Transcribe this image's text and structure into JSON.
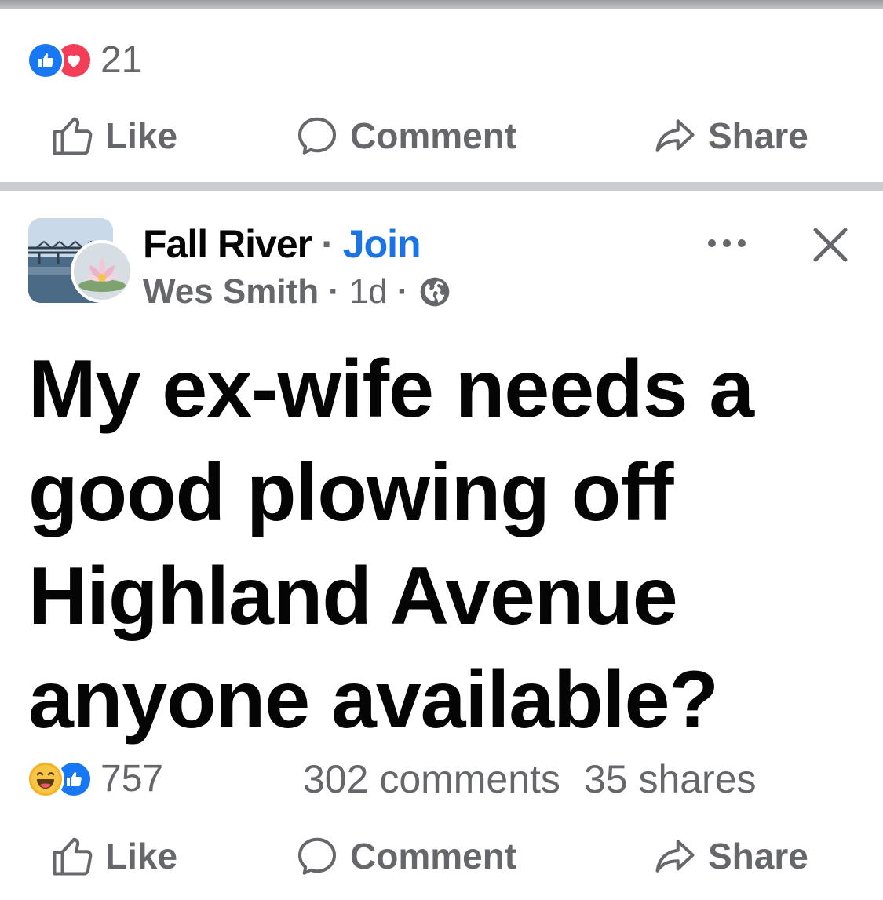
{
  "previous_post": {
    "reaction_count": "21",
    "reaction_icons": [
      "like-icon",
      "love-icon"
    ]
  },
  "actions": {
    "like": "Like",
    "comment": "Comment",
    "share": "Share"
  },
  "post": {
    "group_name": "Fall River",
    "separator": "·",
    "join_label": "Join",
    "author": "Wes Smith",
    "time": "1d",
    "privacy_icon": "globe-icon",
    "text": "My ex-wife needs a good plowing off Highland Avenue anyone available?",
    "reaction_count": "757",
    "reaction_icons": [
      "haha-icon",
      "like-icon"
    ],
    "comments": "302 comments",
    "shares": "35 shares"
  },
  "colors": {
    "accent_blue": "#1b74e4",
    "secondary_text": "#65676b",
    "divider": "#c9ccd1"
  }
}
